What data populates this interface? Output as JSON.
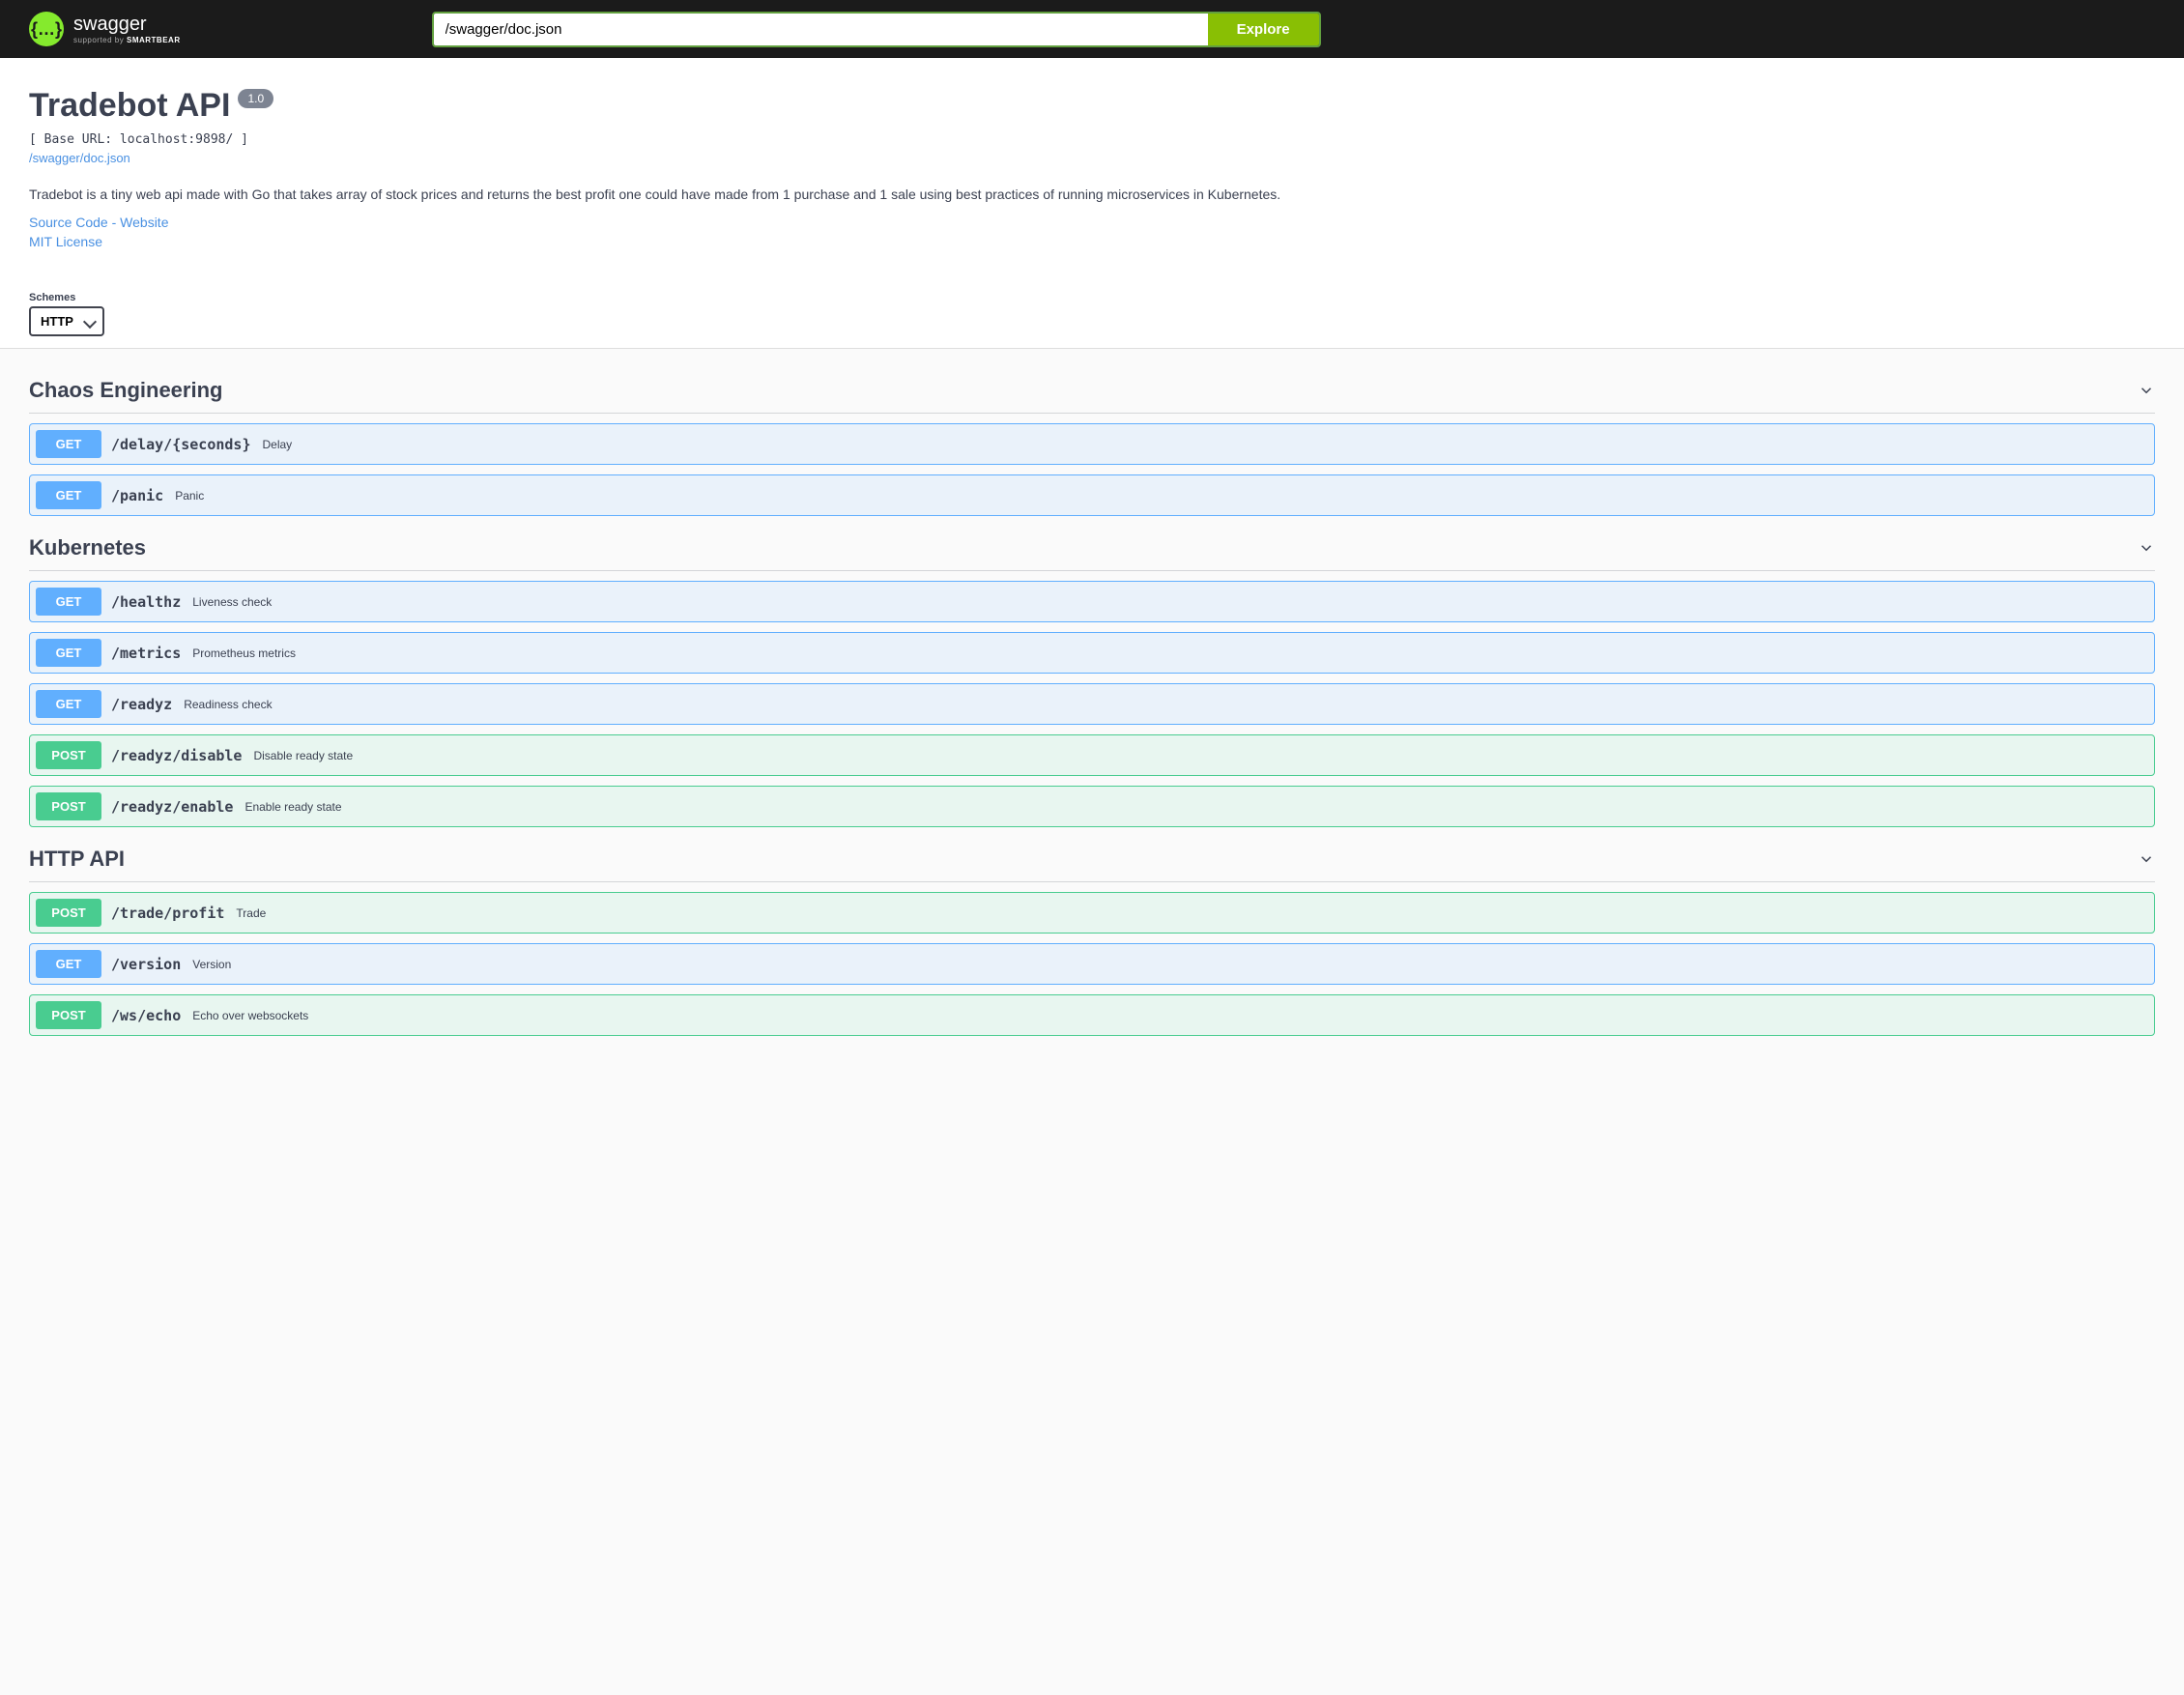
{
  "topbar": {
    "logo_name": "swagger",
    "logo_sub_prefix": "supported by ",
    "logo_sub_brand": "SMARTBEAR",
    "search_value": "/swagger/doc.json",
    "explore_label": "Explore"
  },
  "info": {
    "title": "Tradebot API",
    "version": "1.0",
    "base_url": "[ Base URL: localhost:9898/ ]",
    "doc_link": "/swagger/doc.json",
    "description": "Tradebot is a tiny web api made with Go that takes array of stock prices and returns the best profit one could have made from 1 purchase and 1 sale using best practices of running microservices in Kubernetes.",
    "source_link": "Source Code - Website",
    "license_link": "MIT License"
  },
  "schemes": {
    "label": "Schemes",
    "selected": "HTTP"
  },
  "tags": [
    {
      "name": "Chaos Engineering",
      "operations": [
        {
          "method": "GET",
          "path": "/delay/{seconds}",
          "summary": "Delay"
        },
        {
          "method": "GET",
          "path": "/panic",
          "summary": "Panic"
        }
      ]
    },
    {
      "name": "Kubernetes",
      "operations": [
        {
          "method": "GET",
          "path": "/healthz",
          "summary": "Liveness check"
        },
        {
          "method": "GET",
          "path": "/metrics",
          "summary": "Prometheus metrics"
        },
        {
          "method": "GET",
          "path": "/readyz",
          "summary": "Readiness check"
        },
        {
          "method": "POST",
          "path": "/readyz/disable",
          "summary": "Disable ready state"
        },
        {
          "method": "POST",
          "path": "/readyz/enable",
          "summary": "Enable ready state"
        }
      ]
    },
    {
      "name": "HTTP API",
      "operations": [
        {
          "method": "POST",
          "path": "/trade/profit",
          "summary": "Trade"
        },
        {
          "method": "GET",
          "path": "/version",
          "summary": "Version"
        },
        {
          "method": "POST",
          "path": "/ws/echo",
          "summary": "Echo over websockets"
        }
      ]
    }
  ]
}
